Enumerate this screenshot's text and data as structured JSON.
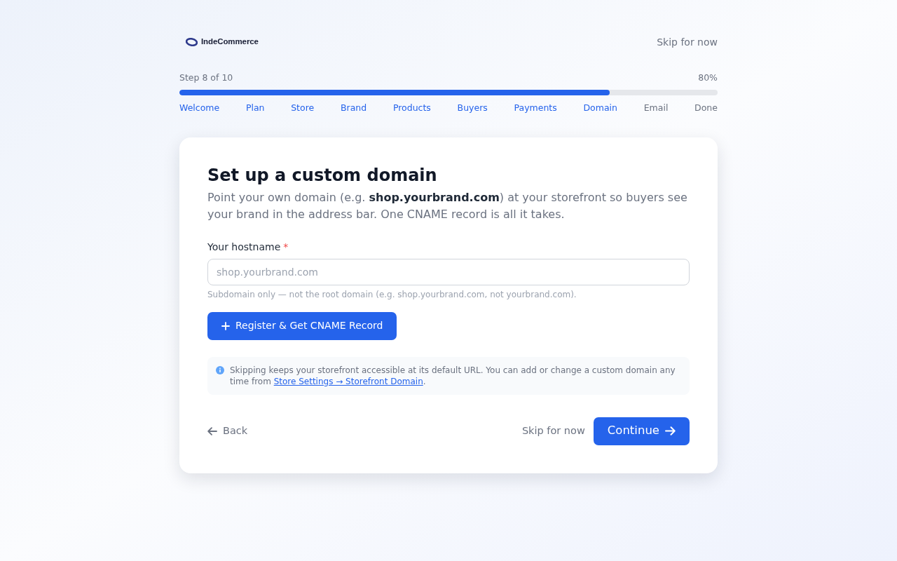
{
  "header": {
    "logo": {
      "text": "IndeCommerce"
    },
    "skip_link": "Skip for now"
  },
  "progress": {
    "label": "Step 8 of 10",
    "percent": "80%",
    "level": 0.8,
    "steps": [
      {
        "label": "Welcome",
        "reached": true
      },
      {
        "label": "Plan",
        "reached": true
      },
      {
        "label": "Store",
        "reached": true
      },
      {
        "label": "Brand",
        "reached": true
      },
      {
        "label": "Products",
        "reached": true
      },
      {
        "label": "Buyers",
        "reached": true
      },
      {
        "label": "Payments",
        "reached": true
      },
      {
        "label": "Domain",
        "reached": true
      },
      {
        "label": "Email",
        "reached": false
      },
      {
        "label": "Done",
        "reached": false
      }
    ]
  },
  "card": {
    "title": "Set up a custom domain",
    "description": "Point your own domain (e.g. **shop.yourbrand.com**) at your storefront so buyers see your brand in the address bar. One CNAME record is all it takes.",
    "field": {
      "label": "Your hostname",
      "required_mark": "*",
      "placeholder": "shop.yourbrand.com",
      "hint": "Subdomain only — not the root domain (e.g. shop.yourbrand.com, not yourbrand.com)."
    },
    "register_button": "Register & Get CNAME Record",
    "note": {
      "text": "Skipping keeps your storefront accessible at its default URL. You can add or change a custom domain any time from ",
      "link": "Store Settings → Storefront Domain",
      "end": "."
    },
    "footer": {
      "back": "Back",
      "skip": "Skip for now",
      "continue": "Continue"
    }
  }
}
